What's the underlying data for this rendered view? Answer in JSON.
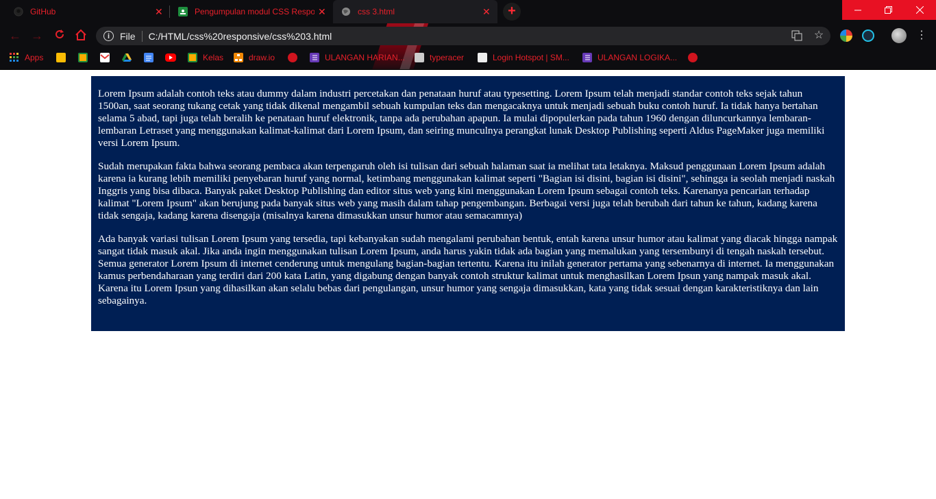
{
  "browser": {
    "tabs": [
      {
        "title": "GitHub",
        "favicon": "github-icon",
        "active": false
      },
      {
        "title": "Pengumpulan modul CSS Respon",
        "favicon": "google-classroom-icon",
        "active": false
      },
      {
        "title": "css 3.html",
        "favicon": "globe-icon",
        "active": true
      }
    ],
    "address": {
      "scheme": "File",
      "url": "C:/HTML/css%20responsive/css%203.html"
    },
    "bookmarks": [
      {
        "label": "Apps",
        "icon": "apps-grid-icon"
      },
      {
        "label": "",
        "icon": "google-keep-icon"
      },
      {
        "label": "",
        "icon": "google-classroom-icon"
      },
      {
        "label": "",
        "icon": "gmail-icon"
      },
      {
        "label": "",
        "icon": "google-drive-icon"
      },
      {
        "label": "",
        "icon": "google-docs-icon"
      },
      {
        "label": "",
        "icon": "youtube-icon"
      },
      {
        "label": "Kelas",
        "icon": "google-classroom-icon"
      },
      {
        "label": "draw.io",
        "icon": "drawio-icon"
      },
      {
        "label": "",
        "icon": "globe-icon"
      },
      {
        "label": "ULANGAN HARIAN...",
        "icon": "google-forms-icon"
      },
      {
        "label": "typeracer",
        "icon": "typeracer-icon"
      },
      {
        "label": "Login Hotspot | SM...",
        "icon": "hotspot-icon"
      },
      {
        "label": "ULANGAN LOGIKA...",
        "icon": "google-forms-icon"
      },
      {
        "label": "",
        "icon": "globe-icon"
      }
    ],
    "colors": {
      "accent": "#e8202a",
      "chrome": "#0d0d10",
      "close": "#e81123"
    }
  },
  "page": {
    "background": "#001f54",
    "paragraphs": [
      "Lorem Ipsum adalah contoh teks atau dummy dalam industri percetakan dan penataan huruf atau typesetting. Lorem Ipsum telah menjadi standar contoh teks sejak tahun 1500an, saat seorang tukang cetak yang tidak dikenal mengambil sebuah kumpulan teks dan mengacaknya untuk menjadi sebuah buku contoh huruf. Ia tidak hanya bertahan selama 5 abad, tapi juga telah beralih ke penataan huruf elektronik, tanpa ada perubahan apapun. Ia mulai dipopulerkan pada tahun 1960 dengan diluncurkannya lembaran-lembaran Letraset yang menggunakan kalimat-kalimat dari Lorem Ipsum, dan seiring munculnya perangkat lunak Desktop Publishing seperti Aldus PageMaker juga memiliki versi Lorem Ipsum.",
      "Sudah merupakan fakta bahwa seorang pembaca akan terpengaruh oleh isi tulisan dari sebuah halaman saat ia melihat tata letaknya. Maksud penggunaan Lorem Ipsum adalah karena ia kurang lebih memiliki penyebaran huruf yang normal, ketimbang menggunakan kalimat seperti \"Bagian isi disini, bagian isi disini\", sehingga ia seolah menjadi naskah Inggris yang bisa dibaca. Banyak paket Desktop Publishing dan editor situs web yang kini menggunakan Lorem Ipsum sebagai contoh teks. Karenanya pencarian terhadap kalimat \"Lorem Ipsum\" akan berujung pada banyak situs web yang masih dalam tahap pengembangan. Berbagai versi juga telah berubah dari tahun ke tahun, kadang karena tidak sengaja, kadang karena disengaja (misalnya karena dimasukkan unsur humor atau semacamnya)",
      "Ada banyak variasi tulisan Lorem Ipsum yang tersedia, tapi kebanyakan sudah mengalami perubahan bentuk, entah karena unsur humor atau kalimat yang diacak hingga nampak sangat tidak masuk akal. Jika anda ingin menggunakan tulisan Lorem Ipsum, anda harus yakin tidak ada bagian yang memalukan yang tersembunyi di tengah naskah tersebut. Semua generator Lorem Ipsum di internet cenderung untuk mengulang bagian-bagian tertentu. Karena itu inilah generator pertama yang sebenarnya di internet. Ia menggunakan kamus perbendaharaan yang terdiri dari 200 kata Latin, yang digabung dengan banyak contoh struktur kalimat untuk menghasilkan Lorem Ipsun yang nampak masuk akal. Karena itu Lorem Ipsun yang dihasilkan akan selalu bebas dari pengulangan, unsur humor yang sengaja dimasukkan, kata yang tidak sesuai dengan karakteristiknya dan lain sebagainya."
    ]
  }
}
